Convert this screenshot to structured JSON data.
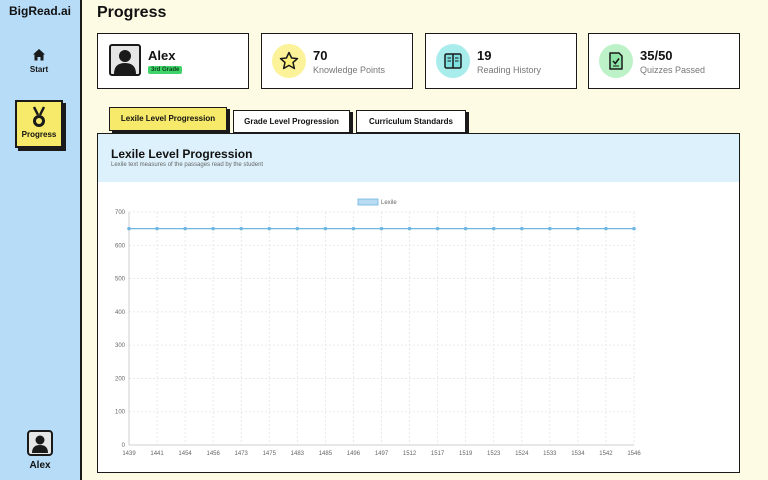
{
  "brand": "BigRead.ai",
  "nav": {
    "start_label": "Start",
    "progress_label": "Progress",
    "user_label": "Alex"
  },
  "page_title": "Progress",
  "profile": {
    "name": "Alex",
    "grade": "3rd Grade"
  },
  "stats": [
    {
      "value": "70",
      "label": "Knowledge Points",
      "icon": "star-icon",
      "color": "#fbf29a"
    },
    {
      "value": "19",
      "label": "Reading History",
      "icon": "book-icon",
      "color": "#a8ecec"
    },
    {
      "value": "35/50",
      "label": "Quizzes Passed",
      "icon": "quiz-check-icon",
      "color": "#bdf2c9"
    }
  ],
  "tabs": [
    {
      "label": "Lexile Level Progression",
      "active": true
    },
    {
      "label": "Grade Level Progression",
      "active": false
    },
    {
      "label": "Curriculum Standards",
      "active": false
    }
  ],
  "panel": {
    "title": "Lexile Level Progression",
    "subtitle": "Lexile text measures of the passages read by the student"
  },
  "colors": {
    "sidebar": "#b7dcf7",
    "accent_yellow": "#f7e96a",
    "series": "#6fb6e3",
    "background": "#fdfbe4"
  },
  "chart_data": {
    "type": "line",
    "x": [
      "1439",
      "1441",
      "1454",
      "1456",
      "1473",
      "1475",
      "1483",
      "1485",
      "1496",
      "1497",
      "1512",
      "1517",
      "1519",
      "1523",
      "1524",
      "1533",
      "1534",
      "1542",
      "1546"
    ],
    "series": [
      {
        "name": "Lexile",
        "values": [
          650,
          650,
          650,
          650,
          650,
          650,
          650,
          650,
          650,
          650,
          650,
          650,
          650,
          650,
          650,
          650,
          650,
          650,
          650
        ]
      }
    ],
    "ylim": [
      0,
      700
    ],
    "yticks": [
      0,
      100,
      200,
      300,
      400,
      500,
      600,
      700
    ],
    "grid": true,
    "legend": "top-center"
  }
}
